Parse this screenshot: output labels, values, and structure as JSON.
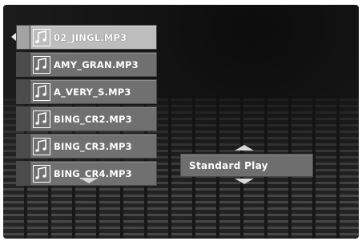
{
  "playlist": {
    "items": [
      {
        "label": "02_JINGL.MP3",
        "icon": "music-note-icon",
        "selected": true
      },
      {
        "label": "AMY_GRAN.MP3",
        "icon": "music-note-icon",
        "selected": false
      },
      {
        "label": "A_VERY_S.MP3",
        "icon": "music-note-icon",
        "selected": false
      },
      {
        "label": "BING_CR2.MP3",
        "icon": "music-note-icon",
        "selected": false
      },
      {
        "label": "BING_CR3.MP3",
        "icon": "music-note-icon",
        "selected": false
      },
      {
        "label": "BING_CR4.MP3",
        "icon": "music-note-icon",
        "selected": false
      }
    ]
  },
  "play_mode": {
    "value": "Standard Play"
  },
  "colors": {
    "selected_item": "#bdbdbd",
    "item": "#707070",
    "background": "#1a1a1a"
  }
}
